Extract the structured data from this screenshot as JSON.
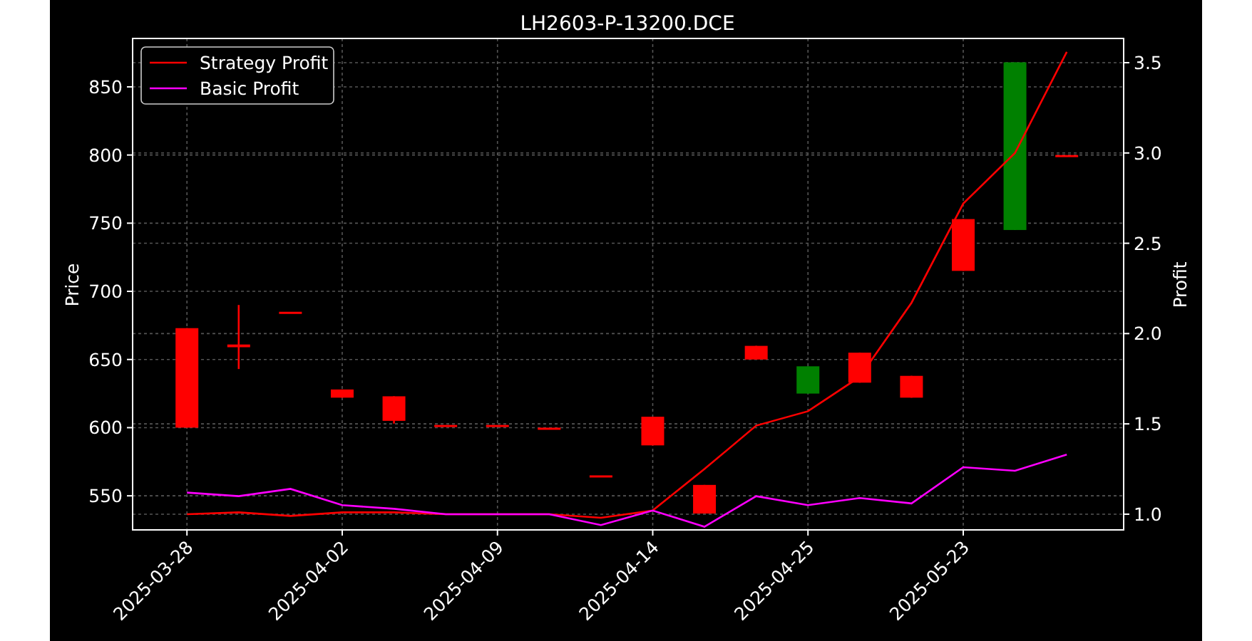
{
  "chart_data": {
    "type": "line",
    "title": "LH2603-P-13200.DCE",
    "ylabel": "Price",
    "y2label": "Profit",
    "categories": [
      "2025-03-28",
      null,
      null,
      "2025-04-02",
      null,
      null,
      "2025-04-09",
      null,
      null,
      "2025-04-14",
      null,
      null,
      "2025-04-25",
      null,
      null,
      "2025-05-23",
      null,
      null
    ],
    "ylim": [
      525,
      885.5
    ],
    "y2lim": [
      0.913,
      3.634
    ],
    "yticks": [
      550,
      600,
      650,
      700,
      750,
      800,
      850
    ],
    "y2ticks": [
      {
        "value": 1.0,
        "label": "1.0"
      },
      {
        "value": 1.5,
        "label": "1.5"
      },
      {
        "value": 2.0,
        "label": "2.0"
      },
      {
        "value": 2.5,
        "label": "2.5"
      },
      {
        "value": 3.0,
        "label": "3.0"
      },
      {
        "value": 3.5,
        "label": "3.5"
      }
    ],
    "grid": true,
    "legend": true,
    "series": [
      {
        "name": "Strategy Profit",
        "color": "#ff0000",
        "axis": "y2",
        "values": [
          1.0,
          1.01,
          0.99,
          1.01,
          1.01,
          1.0,
          1.0,
          1.0,
          0.98,
          1.02,
          1.25,
          1.49,
          1.57,
          1.76,
          2.17,
          2.72,
          3.0,
          3.56
        ]
      },
      {
        "name": "Basic Profit",
        "color": "#ff00ff",
        "axis": "y2",
        "values": [
          1.12,
          1.1,
          1.14,
          1.05,
          1.03,
          1.0,
          1.0,
          1.0,
          0.94,
          1.02,
          0.93,
          1.1,
          1.05,
          1.09,
          1.06,
          1.26,
          1.24,
          1.33
        ]
      }
    ]
  }
}
